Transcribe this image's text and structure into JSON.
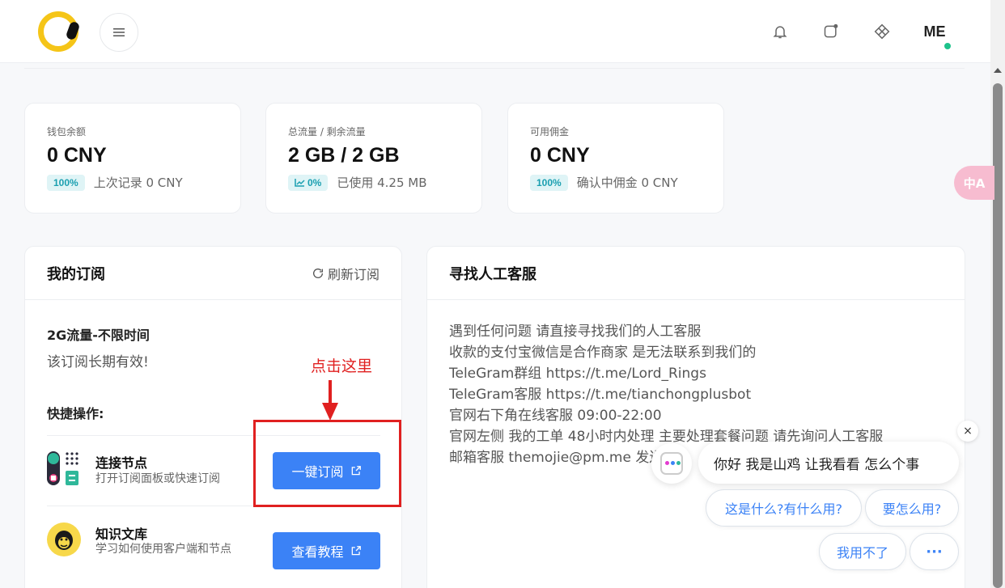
{
  "header": {
    "menu_icon": "hamburger-icon",
    "icons": [
      "bell-icon",
      "chat-icon",
      "grid-icon"
    ],
    "avatar_text": "ME",
    "status_color": "#1ec28b"
  },
  "stats": [
    {
      "label": "钱包余额",
      "value": "0 CNY",
      "badge": "100%",
      "note": "上次记录 0 CNY"
    },
    {
      "label": "总流量 / 剩余流量",
      "value": "2 GB / 2 GB",
      "badge": "0%",
      "note": "已使用 4.25 MB"
    },
    {
      "label": "可用佣金",
      "value": "0 CNY",
      "badge": "100%",
      "note": "确认中佣金 0 CNY"
    }
  ],
  "subscription": {
    "title": "我的订阅",
    "refresh_label": "刷新订阅",
    "plan_name": "2G流量-不限时间",
    "validity": "该订阅长期有效!",
    "quick_actions_label": "快捷操作:",
    "actions": [
      {
        "title": "连接节点",
        "desc": "打开订阅面板或快速订阅",
        "button": "一键订阅"
      },
      {
        "title": "知识文库",
        "desc": "学习如何使用客户端和节点",
        "button": "查看教程"
      }
    ]
  },
  "annotation": {
    "text": "点击这里",
    "color": "#e02020"
  },
  "support": {
    "title": "寻找人工客服",
    "lines": [
      "遇到任何问题 请直接寻找我们的人工客服",
      "收款的支付宝微信是合作商家 是无法联系到我们的",
      "TeleGram群组 https://t.me/Lord_Rings",
      "TeleGram客服 https://t.me/tianchongplusbot",
      "官网右下角在线客服 09:00-22:00",
      "官网左侧 我的工单 48小时内处理 主要处理套餐问题 请先询问人工客服",
      "邮箱客服 themojie@pm.me 发送"
    ]
  },
  "translate": {
    "label": "中A"
  },
  "chat": {
    "close": "×",
    "greeting": "你好 我是山鸡 让我看看 怎么个事",
    "chips": [
      "这是什么?有什么用?",
      "要怎么用?",
      "我用不了",
      "···"
    ]
  },
  "colors": {
    "accent": "#3b82f6",
    "badge_bg": "#dff4f6",
    "badge_text": "#1a9fb0"
  }
}
